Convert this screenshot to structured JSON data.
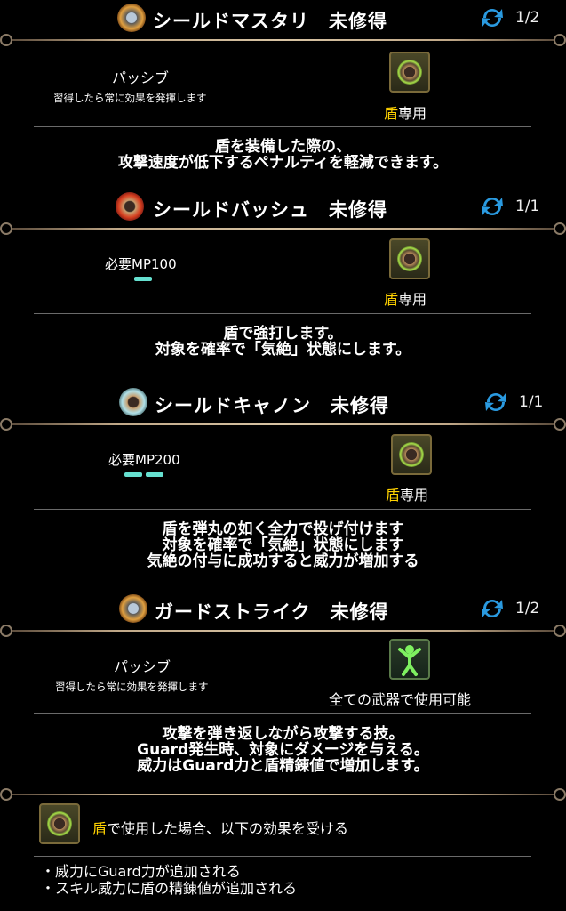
{
  "skills": [
    {
      "name": "シールドマスタリ",
      "status": "未修得",
      "page": "1/2",
      "kind": "パッシブ",
      "kind_note": "習得したら常に効果を発揮します",
      "weapon_prefix": "盾",
      "weapon_suffix": "専用",
      "desc": [
        "盾を装備した際の、",
        "攻撃速度が低下するペナルティを軽減できます。"
      ]
    },
    {
      "name": "シールドバッシュ",
      "status": "未修得",
      "page": "1/1",
      "mp": "必要MP100",
      "mp_level": 1,
      "weapon_prefix": "盾",
      "weapon_suffix": "専用",
      "desc": [
        "盾で強打します。",
        "対象を確率で「気絶」状態にします。"
      ]
    },
    {
      "name": "シールドキャノン",
      "status": "未修得",
      "page": "1/1",
      "mp": "必要MP200",
      "mp_level": 2,
      "weapon_prefix": "盾",
      "weapon_suffix": "専用",
      "desc": [
        "盾を弾丸の如く全力で投げ付けます",
        "対象を確率で「気絶」状態にします",
        "気絶の付与に成功すると威力が増加する"
      ]
    },
    {
      "name": "ガードストライク",
      "status": "未修得",
      "page": "1/2",
      "kind": "パッシブ",
      "kind_note": "習得したら常に効果を発揮します",
      "weapon_all": "全ての武器で使用可能",
      "desc": [
        "攻撃を弾き返しながら攻撃する技。",
        "Guard発生時、対象にダメージを与える。",
        "威力はGuard力と盾精錬値で増加します。"
      ]
    }
  ],
  "bonus": {
    "prefix": "盾",
    "text": "で使用した場合、以下の効果を受ける",
    "items": [
      "・威力にGuard力が追加される",
      "・スキル威力に盾の精錬値が追加される"
    ]
  },
  "colors": {
    "accent_yellow": "#ffd200",
    "mp_bar": "#66e0d0",
    "frame": "#c0a888"
  }
}
